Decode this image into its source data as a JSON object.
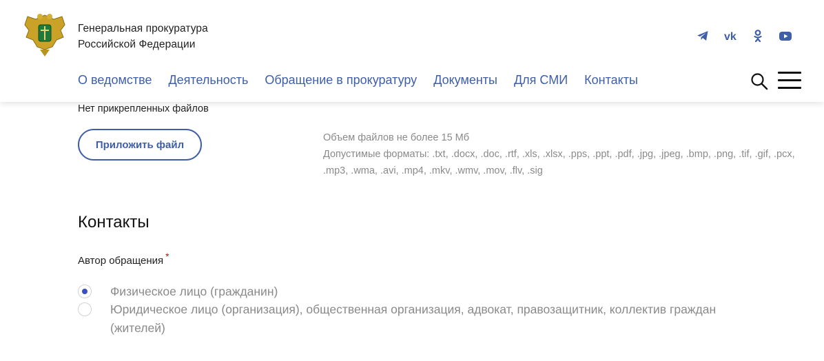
{
  "header": {
    "org_line1": "Генеральная прокуратура",
    "org_line2": "Российской Федерации",
    "social": [
      "telegram-icon",
      "vk-icon",
      "odnoklassniki-icon",
      "youtube-icon"
    ],
    "brand_color": "#3f5ea8"
  },
  "nav": [
    {
      "label": "О ведомстве"
    },
    {
      "label": "Деятельность"
    },
    {
      "label": "Обращение в прокуратуру"
    },
    {
      "label": "Документы"
    },
    {
      "label": "Для СМИ"
    },
    {
      "label": "Контакты"
    }
  ],
  "files": {
    "no_files": "Нет прикрепленных файлов",
    "attach_label": "Приложить файл",
    "size_hint": "Объем файлов не более 15 Мб",
    "formats_hint": "Допустимые форматы: .txt, .docx, .doc, .rtf, .xls, .xlsx, .pps, .ppt, .pdf, .jpg, .jpeg, .bmp, .png, .tif, .gif, .pcx, .mp3, .wma, .avi, .mp4, .mkv, .wmv, .mov, .flv, .sig"
  },
  "contacts": {
    "title": "Контакты",
    "author_label": "Автор обращения",
    "required_mark": "*",
    "options": [
      {
        "label": "Физическое лицо (гражданин)",
        "selected": true
      },
      {
        "label": "Юридическое лицо (организация), общественная организация, адвокат, правозащитник, коллектив граждан (жителей)",
        "selected": false
      }
    ]
  }
}
